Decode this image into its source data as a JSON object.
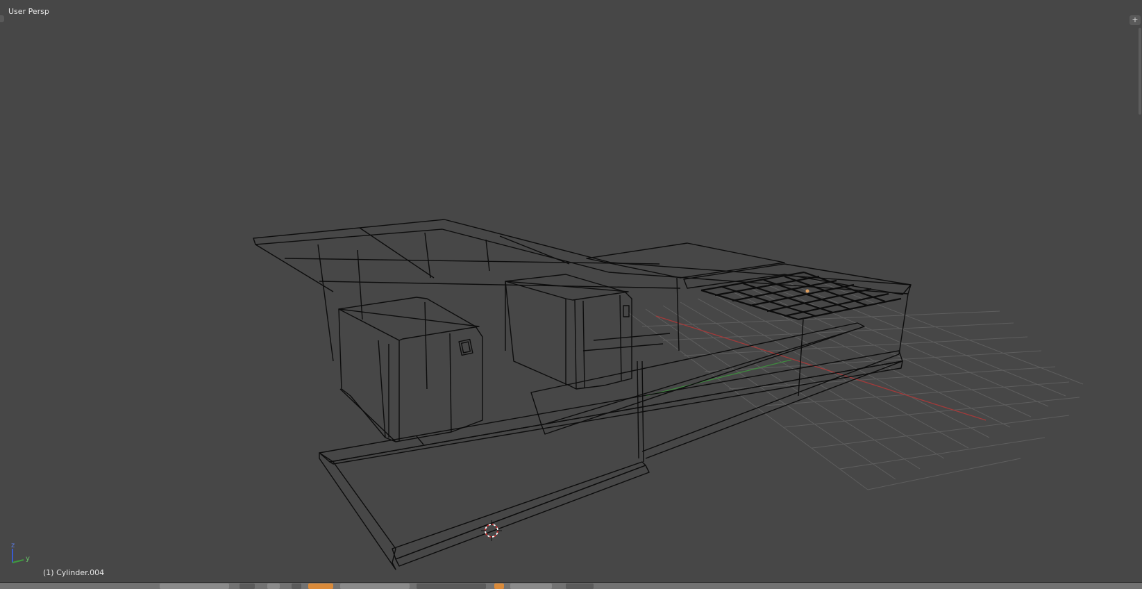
{
  "viewport": {
    "view_label": "User Persp",
    "active_object": "(1) Cylinder.004"
  },
  "axis_gizmo": {
    "z_label": "z",
    "y_label": "y"
  },
  "header_icons": {
    "left_corner": "area-split-widget",
    "right_corner": "plus-icon",
    "right_corner_glyph": "+"
  },
  "colors": {
    "background": "#474747",
    "wireframe": "#0d0d0d",
    "grid": "#5e5e5e",
    "x_axis": "#a33a3a",
    "y_axis": "#3f8a3f",
    "origin": "#e0a060",
    "cursor_red": "#cc2b2b",
    "header_accent": "#d98a3a"
  }
}
